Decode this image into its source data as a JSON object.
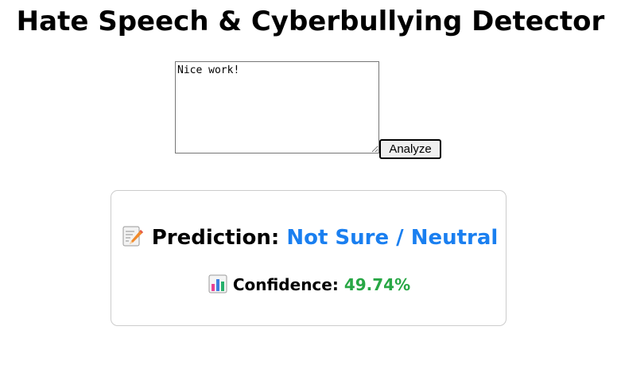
{
  "header": {
    "title": "Hate Speech & Cyberbullying Detector"
  },
  "form": {
    "input_value": "Nice work!",
    "analyze_label": "Analyze"
  },
  "result": {
    "prediction_label": "Prediction:",
    "prediction_value": "Not Sure / Neutral",
    "prediction_icon": "memo-icon",
    "confidence_label": "Confidence:",
    "confidence_value": "49.74%",
    "confidence_icon": "bar-chart-icon",
    "colors": {
      "prediction": "#1a7ff0",
      "confidence": "#28a745",
      "card_border": "#cccccc"
    }
  }
}
